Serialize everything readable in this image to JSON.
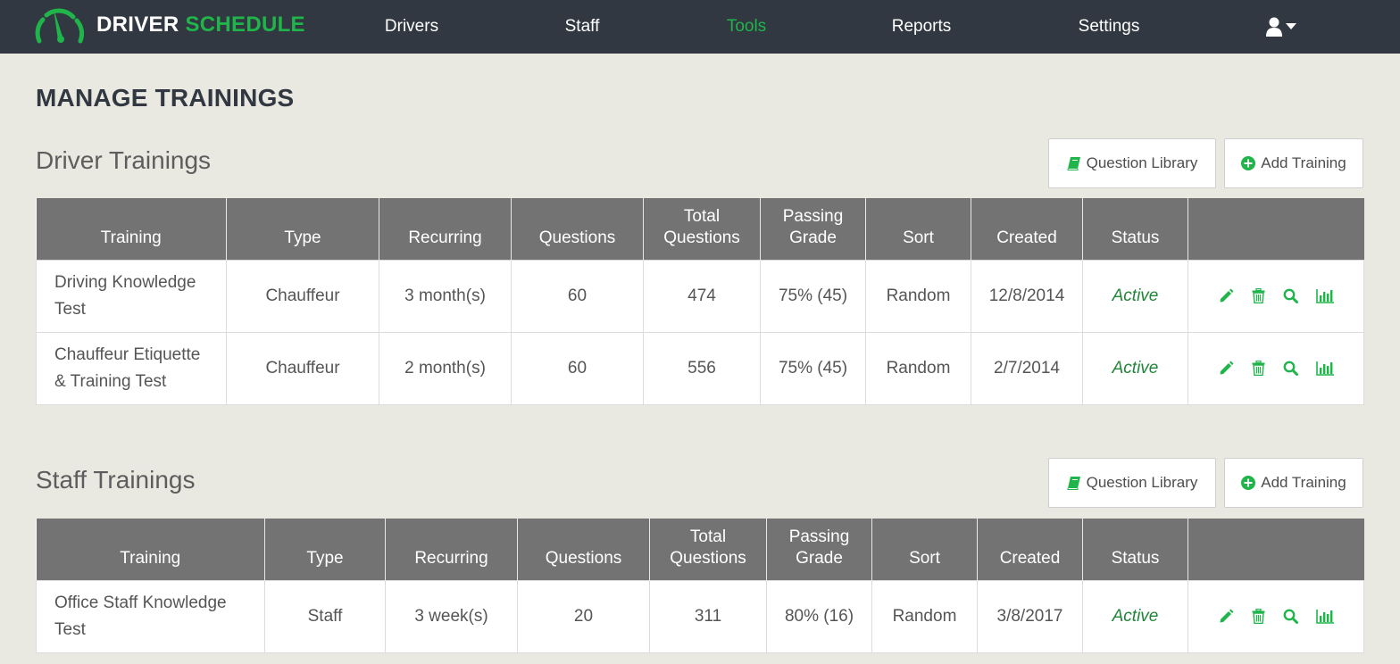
{
  "brand": {
    "word1": "DRIVER",
    "word2": "SCHEDULE"
  },
  "nav": [
    "Drivers",
    "Staff",
    "Tools",
    "Reports",
    "Settings"
  ],
  "page_title": "MANAGE TRAININGS",
  "buttons": {
    "question_library": "Question Library",
    "add_training": "Add Training"
  },
  "columns": {
    "training": "Training",
    "type": "Type",
    "recurring": "Recurring",
    "questions": "Questions",
    "total_1": "Total",
    "total_2": "Questions",
    "passing_1": "Passing",
    "passing_2": "Grade",
    "sort": "Sort",
    "created": "Created",
    "status": "Status"
  },
  "driver": {
    "title": "Driver Trainings",
    "rows": [
      {
        "name_1": "Driving Knowledge",
        "name_2": "Test",
        "type": "Chauffeur",
        "recurring": "3 month(s)",
        "questions": "60",
        "total": "474",
        "passing": "75% (45)",
        "sort": "Random",
        "created": "12/8/2014",
        "status": "Active"
      },
      {
        "name_1": "Chauffeur Etiquette",
        "name_2": "& Training Test",
        "type": "Chauffeur",
        "recurring": "2 month(s)",
        "questions": "60",
        "total": "556",
        "passing": "75% (45)",
        "sort": "Random",
        "created": "2/7/2014",
        "status": "Active"
      }
    ]
  },
  "staff": {
    "title": "Staff Trainings",
    "rows": [
      {
        "name_1": "Office Staff Knowledge",
        "name_2": "Test",
        "type": "Staff",
        "recurring": "3 week(s)",
        "questions": "20",
        "total": "311",
        "passing": "80% (16)",
        "sort": "Random",
        "created": "3/8/2017",
        "status": "Active"
      }
    ]
  },
  "colors": {
    "accent": "#1fb54a",
    "navbar": "#323841",
    "header": "#737373",
    "background": "#e9e8e1"
  },
  "icons": [
    "speedometer-logo-icon",
    "user-icon",
    "caret-down-icon",
    "book-icon",
    "plus-circle-icon",
    "pencil-icon",
    "trash-icon",
    "search-icon",
    "bar-chart-icon"
  ]
}
